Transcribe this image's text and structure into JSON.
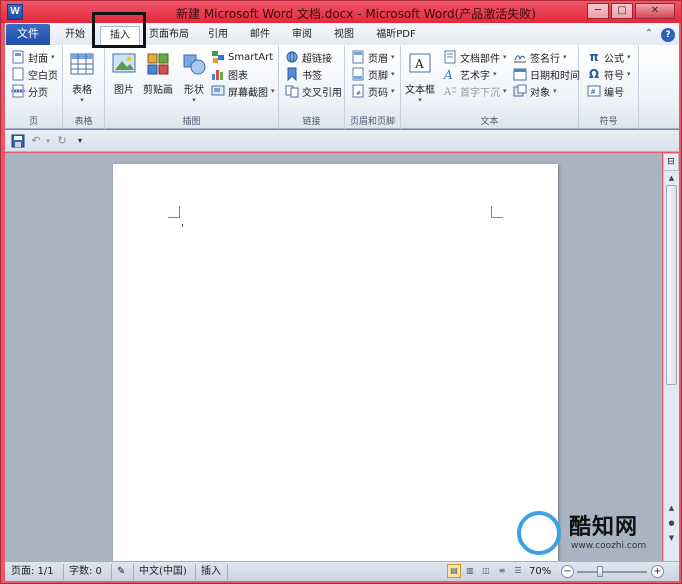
{
  "window": {
    "title": "新建 Microsoft Word 文档.docx - Microsoft Word(产品激活失败)",
    "app_icon_letter": "W",
    "controls": {
      "minimize": "─",
      "maximize": "□",
      "close": "✕"
    }
  },
  "tabs": {
    "file": "文件",
    "items": [
      "开始",
      "插入",
      "页面布局",
      "引用",
      "邮件",
      "审阅",
      "视图",
      "福昕PDF"
    ],
    "active": "插入"
  },
  "ribbon": {
    "pages": {
      "label": "页",
      "cover": "封面",
      "blank": "空白页",
      "break": "分页"
    },
    "tables": {
      "label": "表格",
      "table": "表格"
    },
    "illustrations": {
      "label": "插图",
      "picture": "图片",
      "clipart": "剪贴画",
      "shapes": "形状",
      "smartart": "SmartArt",
      "chart": "图表",
      "screenshot": "屏幕截图"
    },
    "links": {
      "label": "链接",
      "hyperlink": "超链接",
      "bookmark": "书签",
      "crossref": "交叉引用"
    },
    "header_footer": {
      "label": "页眉和页脚",
      "header": "页眉",
      "footer": "页脚",
      "pagenum": "页码"
    },
    "text": {
      "label": "文本",
      "textbox": "文本框",
      "quickparts": "文档部件",
      "wordart": "艺术字",
      "dropcap": "首字下沉",
      "signature": "签名行",
      "datetime": "日期和时间",
      "object": "对象"
    },
    "symbols": {
      "label": "符号",
      "equation": "公式",
      "symbol": "符号",
      "number": "编号"
    }
  },
  "status": {
    "page": "页面: 1/1",
    "words": "字数: 0",
    "language": "中文(中国)",
    "mode": "插入",
    "zoom": "70%",
    "zoom_level": 0.7
  },
  "watermark": {
    "brand": "酷知网",
    "url": "www.coozhi.com"
  }
}
